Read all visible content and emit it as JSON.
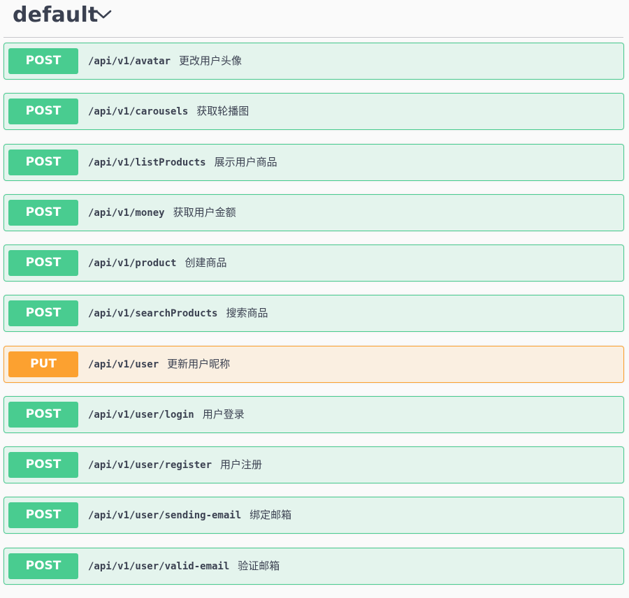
{
  "section": {
    "title": "default"
  },
  "operations": [
    {
      "method": "POST",
      "path": "/api/v1/avatar",
      "summary": "更改用户头像"
    },
    {
      "method": "POST",
      "path": "/api/v1/carousels",
      "summary": "获取轮播图"
    },
    {
      "method": "POST",
      "path": "/api/v1/listProducts",
      "summary": "展示用户商品"
    },
    {
      "method": "POST",
      "path": "/api/v1/money",
      "summary": "获取用户金额"
    },
    {
      "method": "POST",
      "path": "/api/v1/product",
      "summary": "创建商品"
    },
    {
      "method": "POST",
      "path": "/api/v1/searchProducts",
      "summary": "搜索商品"
    },
    {
      "method": "PUT",
      "path": "/api/v1/user",
      "summary": "更新用户昵称"
    },
    {
      "method": "POST",
      "path": "/api/v1/user/login",
      "summary": "用户登录"
    },
    {
      "method": "POST",
      "path": "/api/v1/user/register",
      "summary": "用户注册"
    },
    {
      "method": "POST",
      "path": "/api/v1/user/sending-email",
      "summary": "绑定邮箱"
    },
    {
      "method": "POST",
      "path": "/api/v1/user/valid-email",
      "summary": "验证邮箱"
    }
  ],
  "colors": {
    "post": "#49cc90",
    "put": "#fca130",
    "text": "#3b4151"
  },
  "icons": {
    "collapse": "chevron-down-icon"
  }
}
